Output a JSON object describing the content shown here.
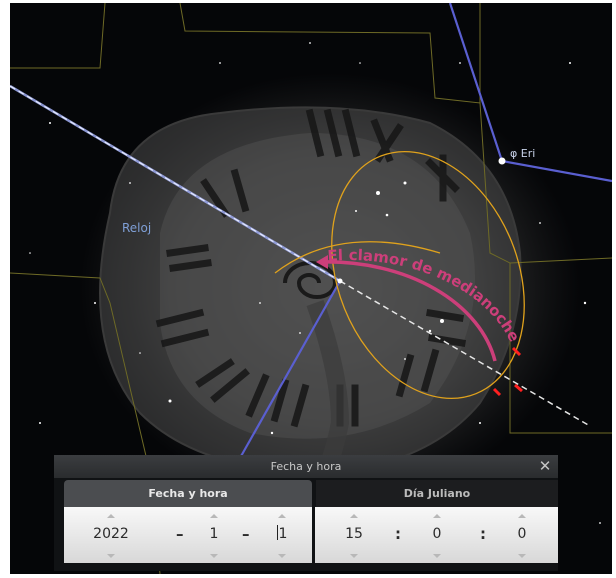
{
  "sky": {
    "constellation_label": "Reloj",
    "star_label": "φ Eri",
    "meteor_shower_label": "El clamor de medianoche",
    "colors": {
      "background": "#050608",
      "constellation_lines": "#5a5fd0",
      "boundaries": "#6e6a26",
      "ecliptic": "#cfd5ee",
      "orbit": "#e0a21c",
      "meteor_label": "#cc3f7a"
    }
  },
  "dialog": {
    "title": "Fecha y hora",
    "close_icon": "close-icon",
    "tabs": [
      {
        "label": "Fecha y hora",
        "active": true
      },
      {
        "label": "Día Juliano",
        "active": false
      }
    ],
    "date": {
      "year": "2022",
      "month": "1",
      "day": "1",
      "separator": "–"
    },
    "time": {
      "hour": "15",
      "minute": "0",
      "second": "0",
      "separator": ":"
    }
  }
}
